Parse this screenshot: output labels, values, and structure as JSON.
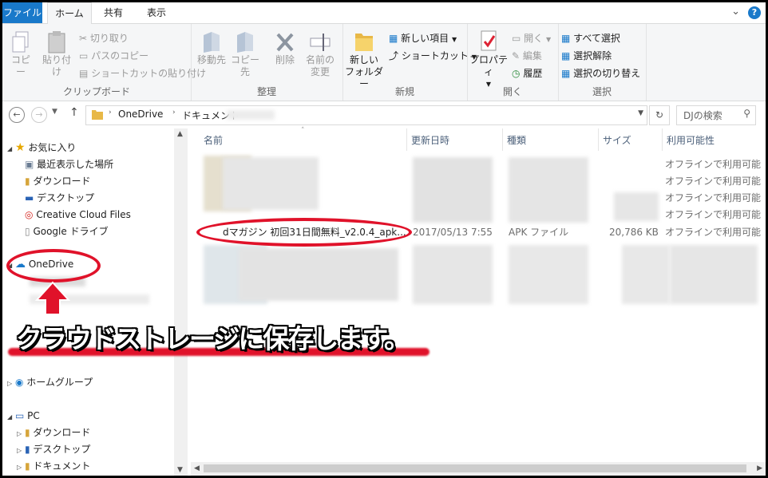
{
  "ribbon_tabs": [
    "ファイル",
    "ホーム",
    "共有",
    "表示"
  ],
  "ribbon": {
    "clipboard": {
      "copy": "コピー",
      "paste": "貼り付け",
      "cut": "切り取り",
      "copy_path": "パスのコピー",
      "paste_shortcut": "ショートカットの貼り付け",
      "label": "クリップボード"
    },
    "organize": {
      "move_to": "移動先",
      "copy_to": "コピー先",
      "delete": "削除",
      "rename_line1": "名前の",
      "rename_line2": "変更",
      "label": "整理"
    },
    "new": {
      "new_folder_line1": "新しい",
      "new_folder_line2": "フォルダー",
      "new_item": "新しい項目",
      "shortcut": "ショートカット",
      "label": "新規"
    },
    "open": {
      "properties": "プロパティ",
      "open": "開く",
      "edit": "編集",
      "history": "履歴",
      "label": "開く"
    },
    "select": {
      "select_all": "すべて選択",
      "select_none": "選択解除",
      "invert": "選択の切り替え",
      "label": "選択"
    }
  },
  "address": {
    "path": [
      "OneDrive",
      "ドキュメント"
    ],
    "search_placeholder": "DJの検索"
  },
  "nav": {
    "favorites": "お気に入り",
    "favorites_items": [
      "最近表示した場所",
      "ダウンロード",
      "デスクトップ",
      "Creative Cloud Files",
      "Google ドライブ"
    ],
    "onedrive": "OneDrive",
    "homegroup": "ホームグループ",
    "pc": "PC",
    "pc_items": [
      "ダウンロード",
      "デスクトップ",
      "ドキュメント"
    ]
  },
  "columns": {
    "name": "名前",
    "date": "更新日時",
    "type": "種類",
    "size": "サイズ",
    "availability": "利用可能性"
  },
  "file": {
    "name": "dマガジン 初回31日間無料_v2.0.4_apk...",
    "date": "2017/05/13 7:55",
    "type": "APK ファイル",
    "size": "20,786 KB",
    "availability": "オフラインで利用可能"
  },
  "availability_text": "オフラインで利用可能",
  "callout": "クラウドストレージに保存します。",
  "colors": {
    "accent": "#1979ca",
    "highlight": "#e0122a"
  }
}
